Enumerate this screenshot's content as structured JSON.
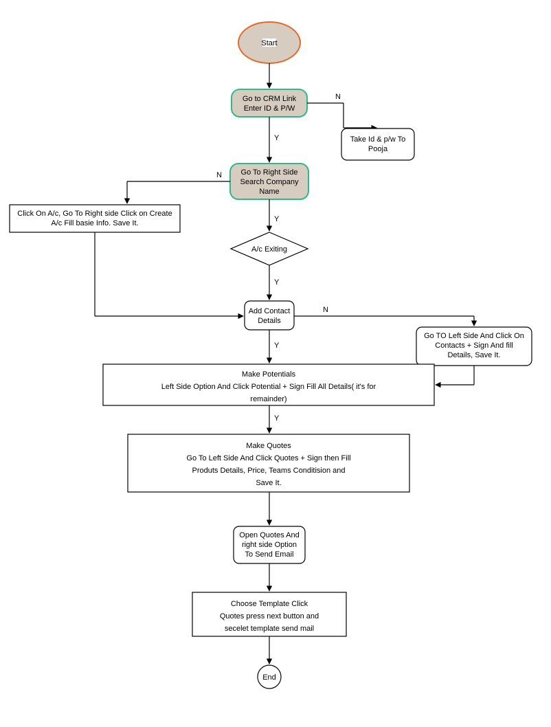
{
  "nodes": {
    "start": "Start",
    "crm_link_line1": "Go to CRM Link",
    "crm_link_line2": "Enter ID & P/W",
    "take_id_line1": "Take Id & p/w  To",
    "take_id_line2": "Pooja",
    "search_line1": "Go To Right Side",
    "search_line2": "Search Company",
    "search_line3": "Name",
    "create_ac_line1": "Click On A/c, Go To Right side Click on Create",
    "create_ac_line2": "A/c Fill basie Info. Save It.",
    "ac_exiting": "A/c Exiting",
    "add_contact_line1": "Add Contact",
    "add_contact_line2": "Details",
    "goto_left_line1": "Go TO Left Side And Click On",
    "goto_left_line2": "Contacts + Sign And fill",
    "goto_left_line3": "Details, Save It.",
    "potentials_line1": "Make Potentials",
    "potentials_line2": "Left Side Option And Click Potential + Sign Fill All Details( it's for",
    "potentials_line3": "remainder)",
    "quotes_line1": "Make Quotes",
    "quotes_line2": "Go To Left Side And Click Quotes + Sign then Fill",
    "quotes_line3": "Produts Details, Price, Teams Conditision and",
    "quotes_line4": "Save It.",
    "open_quotes_line1": "Open Quotes And",
    "open_quotes_line2": "right side Option",
    "open_quotes_line3": "To Send Email",
    "template_line1": "Choose Template Click",
    "template_line2": "Quotes press next button and",
    "template_line3": "secelet template send mail",
    "end": "End"
  },
  "labels": {
    "y": "Y",
    "n": "N"
  }
}
